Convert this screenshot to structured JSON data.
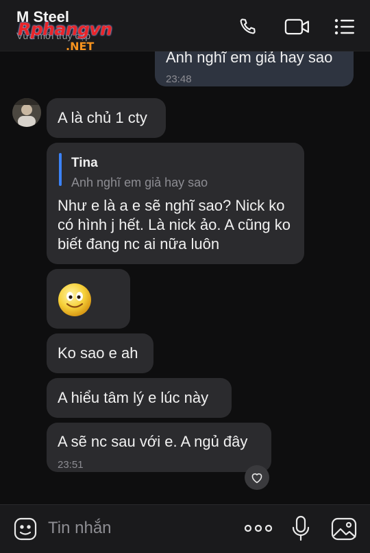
{
  "header": {
    "title": "M Steel",
    "status": "Vừa mới truy cập",
    "icons": [
      "phone-icon",
      "video-call-icon",
      "menu-icon"
    ]
  },
  "watermark": {
    "main": "Rphangvn",
    "suffix": ".NET"
  },
  "messages": [
    {
      "sender": "me",
      "text": "Anh nghĩ em giả hay sao",
      "time": "23:48"
    },
    {
      "sender": "M Steel",
      "text": "A là chủ 1 cty"
    },
    {
      "sender": "M Steel",
      "reply_to": {
        "name": "Tina",
        "text": "Anh nghĩ em giả hay sao"
      },
      "text": "Như e là a e sẽ nghĩ sao? Nick ko có hình j hết. Là nick ảo. A cũng ko biết đang nc ai nữa luôn"
    },
    {
      "sender": "M Steel",
      "sticker": "smile-emoji"
    },
    {
      "sender": "M Steel",
      "text": "Ko sao e ah"
    },
    {
      "sender": "M Steel",
      "text": "A hiểu tâm lý e lúc này"
    },
    {
      "sender": "M Steel",
      "text": "A sẽ nc sau với e. A ngủ đây",
      "time": "23:51",
      "reaction": "heart-icon"
    }
  ],
  "composer": {
    "placeholder": "Tin nhắn",
    "icons": [
      "sticker-icon",
      "more-icon",
      "microphone-icon",
      "image-icon"
    ]
  },
  "colors": {
    "background": "#0e0e0f",
    "bubble": "#2b2b2e",
    "accent": "#3b82f6",
    "watermark_red": "#e8242a",
    "watermark_orange": "#f7931e"
  }
}
